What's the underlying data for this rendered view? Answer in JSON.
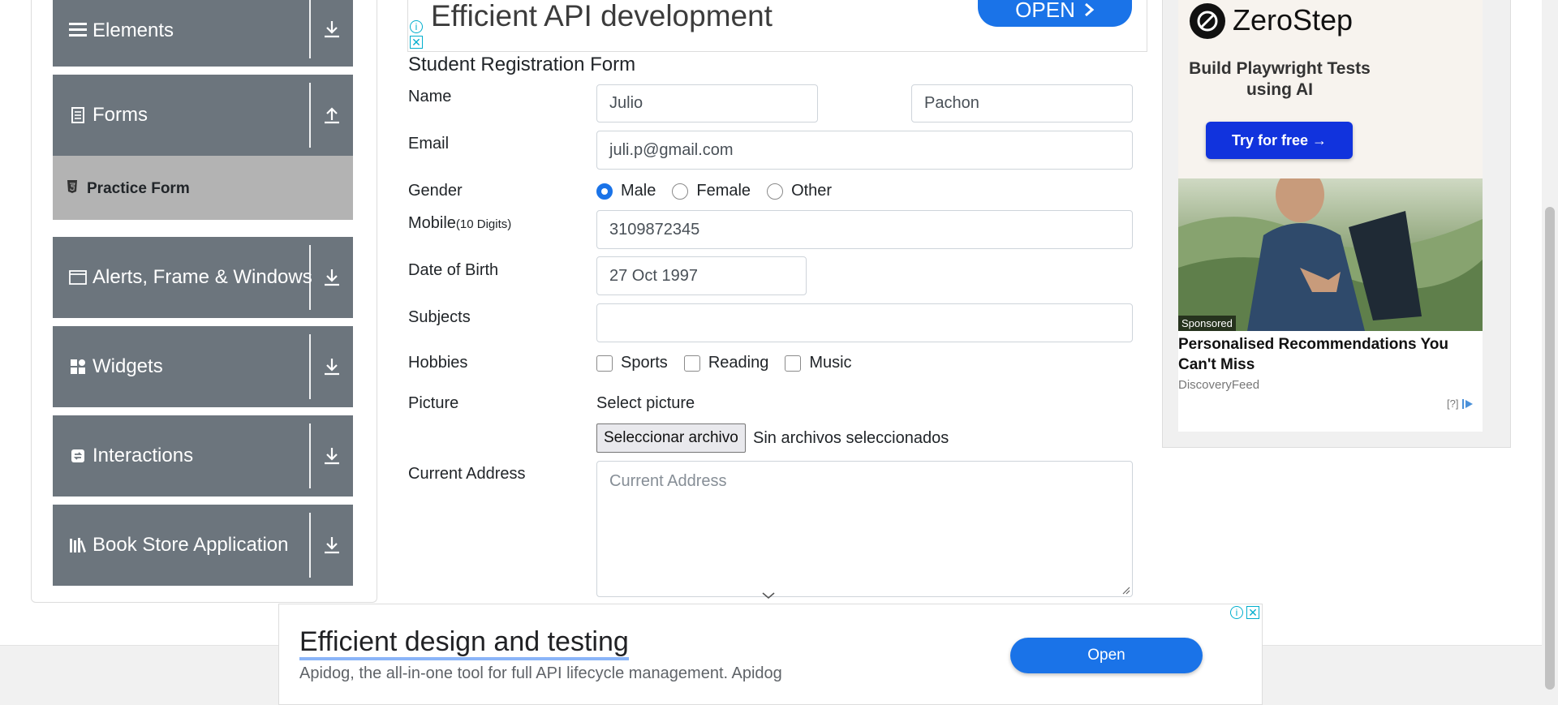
{
  "sidebar": {
    "groups": [
      {
        "label": "Elements",
        "icon": "hamburger-icon",
        "expanded": false
      },
      {
        "label": "Forms",
        "icon": "form-icon",
        "expanded": true
      },
      {
        "label": "Alerts, Frame & Windows",
        "icon": "window-icon",
        "expanded": false
      },
      {
        "label": "Widgets",
        "icon": "widgets-icon",
        "expanded": false
      },
      {
        "label": "Interactions",
        "icon": "interactions-icon",
        "expanded": false
      },
      {
        "label": "Book Store Application",
        "icon": "books-icon",
        "expanded": false
      }
    ],
    "active_item": "Practice Form"
  },
  "form": {
    "title": "Student Registration Form",
    "name_label": "Name",
    "first_name": "Julio",
    "last_name": "Pachon",
    "email_label": "Email",
    "email": "juli.p@gmail.com",
    "gender_label": "Gender",
    "gender_options": [
      "Male",
      "Female",
      "Other"
    ],
    "gender_selected": "Male",
    "mobile_label": "Mobile",
    "mobile_hint": "(10 Digits)",
    "mobile": "3109872345",
    "dob_label": "Date of Birth",
    "dob": "27 Oct 1997",
    "subjects_label": "Subjects",
    "subjects": "",
    "hobbies_label": "Hobbies",
    "hobbies": [
      "Sports",
      "Reading",
      "Music"
    ],
    "picture_label": "Picture",
    "picture_prompt": "Select picture",
    "file_button": "Seleccionar archivo",
    "file_status": "Sin archivos seleccionados",
    "address_label": "Current Address",
    "address_placeholder": "Current Address"
  },
  "ads": {
    "top_banner": {
      "text": "Efficient API development",
      "button": "OPEN"
    },
    "right": {
      "brand": "ZeroStep",
      "tagline": "Build Playwright Tests using AI",
      "button": "Try for free →",
      "sponsored": "Sponsored",
      "headline": "Personalised Recommendations You Can't Miss",
      "source": "DiscoveryFeed",
      "choices": "[?]"
    },
    "bottom_banner": {
      "title": "Efficient design and testing",
      "subtitle": "Apidog, the all-in-one tool for full API lifecycle management. Apidog",
      "button": "Open"
    }
  },
  "colors": {
    "sidebar_bg": "#6c757d",
    "active_item_bg": "#b3b3b3",
    "accent": "#1a73e8"
  }
}
